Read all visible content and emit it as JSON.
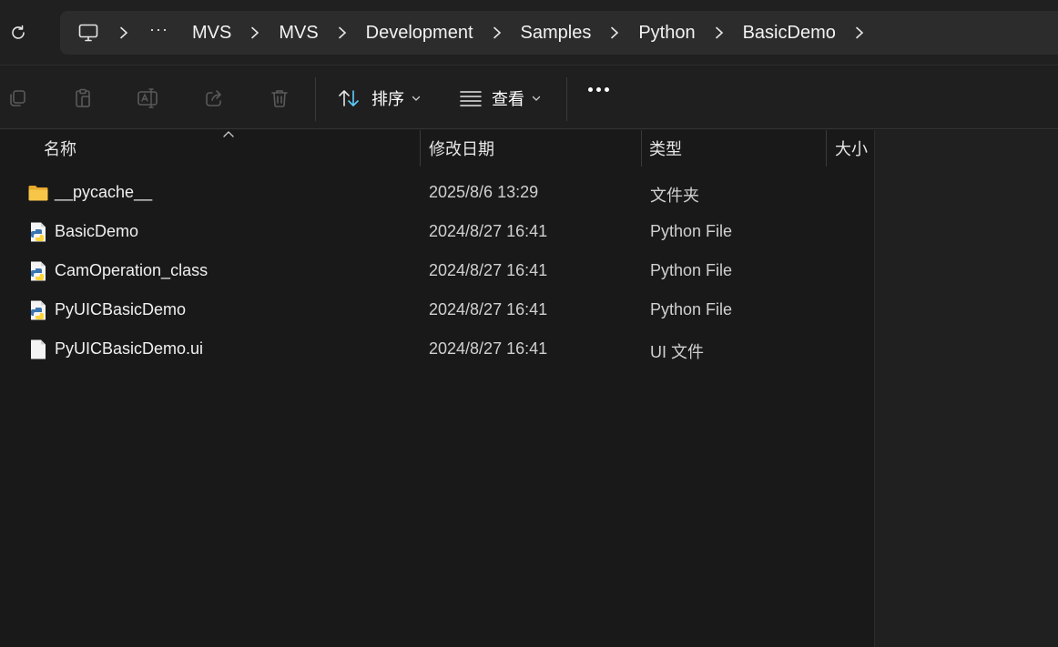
{
  "breadcrumb": {
    "overflow_label": "···",
    "items": [
      "MVS",
      "MVS",
      "Development",
      "Samples",
      "Python",
      "BasicDemo"
    ]
  },
  "toolbar": {
    "sort_label": "排序",
    "view_label": "查看"
  },
  "columns": {
    "name": "名称",
    "date": "修改日期",
    "type": "类型",
    "size": "大小"
  },
  "files": [
    {
      "name": "__pycache__",
      "date": "2025/8/6 13:29",
      "type": "文件夹",
      "icon": "folder-icon"
    },
    {
      "name": "BasicDemo",
      "date": "2024/8/27 16:41",
      "type": "Python File",
      "icon": "python-file-icon"
    },
    {
      "name": "CamOperation_class",
      "date": "2024/8/27 16:41",
      "type": "Python File",
      "icon": "python-file-icon"
    },
    {
      "name": "PyUICBasicDemo",
      "date": "2024/8/27 16:41",
      "type": "Python File",
      "icon": "python-file-icon"
    },
    {
      "name": "PyUICBasicDemo.ui",
      "date": "2024/8/27 16:41",
      "type": "UI 文件",
      "icon": "file-icon"
    }
  ],
  "colors": {
    "folder": "#f7c548",
    "python_blue": "#3a75b0",
    "python_yellow": "#ffd43b",
    "sort_accent": "#60cdff"
  }
}
